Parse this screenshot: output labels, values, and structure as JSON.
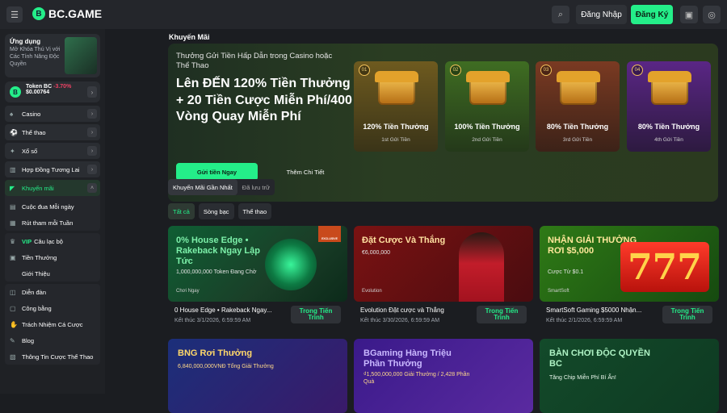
{
  "topbar": {
    "logo_text": "BC.GAME",
    "login_label": "Đăng Nhập",
    "signup_label": "Đăng Ký"
  },
  "sidebar": {
    "app_title": "Ứng dụng",
    "app_desc": "Mở Khóa Thú Vị với Các Tính Năng Độc Quyền",
    "token_name": "Token BC",
    "token_change": "-3.70%",
    "token_price": "$0.00764",
    "items": [
      {
        "label": "Casino",
        "icon": "cards-icon",
        "chevron": "›"
      },
      {
        "label": "Thể thao",
        "icon": "ball-icon",
        "chevron": "›"
      },
      {
        "label": "Xổ số",
        "icon": "lottery-icon",
        "chevron": "›"
      },
      {
        "label": "Hợp Đồng Tương Lai",
        "icon": "chart-icon",
        "chevron": "›"
      }
    ],
    "promo_label": "Khuyến mãi",
    "promo_sub": [
      {
        "label": "Cuộc đua Mỗi ngày"
      },
      {
        "label": "Rút tham mỗi Tuần"
      }
    ],
    "vip_tag": "VIP",
    "club_label": "Câu lạc bộ",
    "club_sub": [
      {
        "label": "Tiền Thưởng"
      },
      {
        "label": "Giới Thiệu"
      }
    ],
    "bottom_items": [
      {
        "label": "Diễn đàn"
      },
      {
        "label": "Công bằng"
      },
      {
        "label": "Trách Nhiệm Cá Cược"
      },
      {
        "label": "Blog"
      },
      {
        "label": "Thông Tin Cược Thể Thao"
      }
    ]
  },
  "main": {
    "section_title": "Khuyến Mãi",
    "hero": {
      "subtitle": "Thưởng Gửi Tiền Hấp Dẫn trong Casino hoặc Thể Thao",
      "title": "Lên ĐẾN 120% Tiền Thưởng + 20 Tiền Cược Miễn Phí/400 Vòng Quay Miễn Phí",
      "cta": "Gửi tiền Ngay",
      "more": "Thêm Chi Tiết",
      "tiers": [
        {
          "badge": "01",
          "amount": "120% Tiền Thưởng",
          "label": "1st Gửi Tiền",
          "color": "#c8962a"
        },
        {
          "badge": "02",
          "amount": "100% Tiền Thưởng",
          "label": "2nd Gửi Tiền",
          "color": "#5e9a2c"
        },
        {
          "badge": "03",
          "amount": "80% Tiền Thưởng",
          "label": "3rd Gửi Tiền",
          "color": "#b44a2a"
        },
        {
          "badge": "04",
          "amount": "80% Tiền Thưởng",
          "label": "4th Gửi Tiền",
          "color": "#7a2fb0"
        }
      ]
    },
    "tabs": [
      "Khuyến Mãi Gần Nhất",
      "Đã lưu trữ"
    ],
    "filters": [
      "Tất cả",
      "Sòng bạc",
      "Thể thao"
    ],
    "cards": [
      {
        "img_title": "0% House Edge • Rakeback Ngay Lập Tức",
        "img_sub": "1,000,000,000 Token Đang Chờ",
        "img_foot": "Chơi Ngay",
        "badge": "EXCLUSIVE",
        "name": "0 House Edge • Rakeback Ngay...",
        "date": "Kết thúc 3/1/2026, 6:59:59 AM",
        "progress": "Trong Tiến Trình"
      },
      {
        "img_title": "Đặt Cược Và Thắng",
        "img_sub": "€6,000,000",
        "img_foot": "Evolution",
        "name": "Evolution Đặt cược và Thắng",
        "date": "Kết thúc 3/30/2026, 6:59:59 AM",
        "progress": "Trong Tiến Trình"
      },
      {
        "img_title": "NHẬN GIẢI THƯỞNG RƠI $5,000",
        "img_sub": "Cược Từ $0.1",
        "img_foot": "SmartSoft",
        "name": "SmartSoft Gaming $5000 Nhận...",
        "date": "Kết thúc 2/1/2026, 6:59:59 AM",
        "progress": "Trong Tiến Trình"
      }
    ],
    "mini_cards": [
      {
        "title": "BNG Rơi Thưởng",
        "sub": "6,840,000,000VNĐ Tổng Giải Thưởng"
      },
      {
        "title": "BGaming Hàng Triệu Phần Thưởng",
        "sub": "₫1,500,000,000 Giải Thưởng / 2,428 Phần Quà"
      },
      {
        "title": "BÀN CHƠI ĐỘC QUYỀN BC",
        "sub": "Tăng Chip Miễn Phí Bí Ẩn!"
      }
    ]
  }
}
